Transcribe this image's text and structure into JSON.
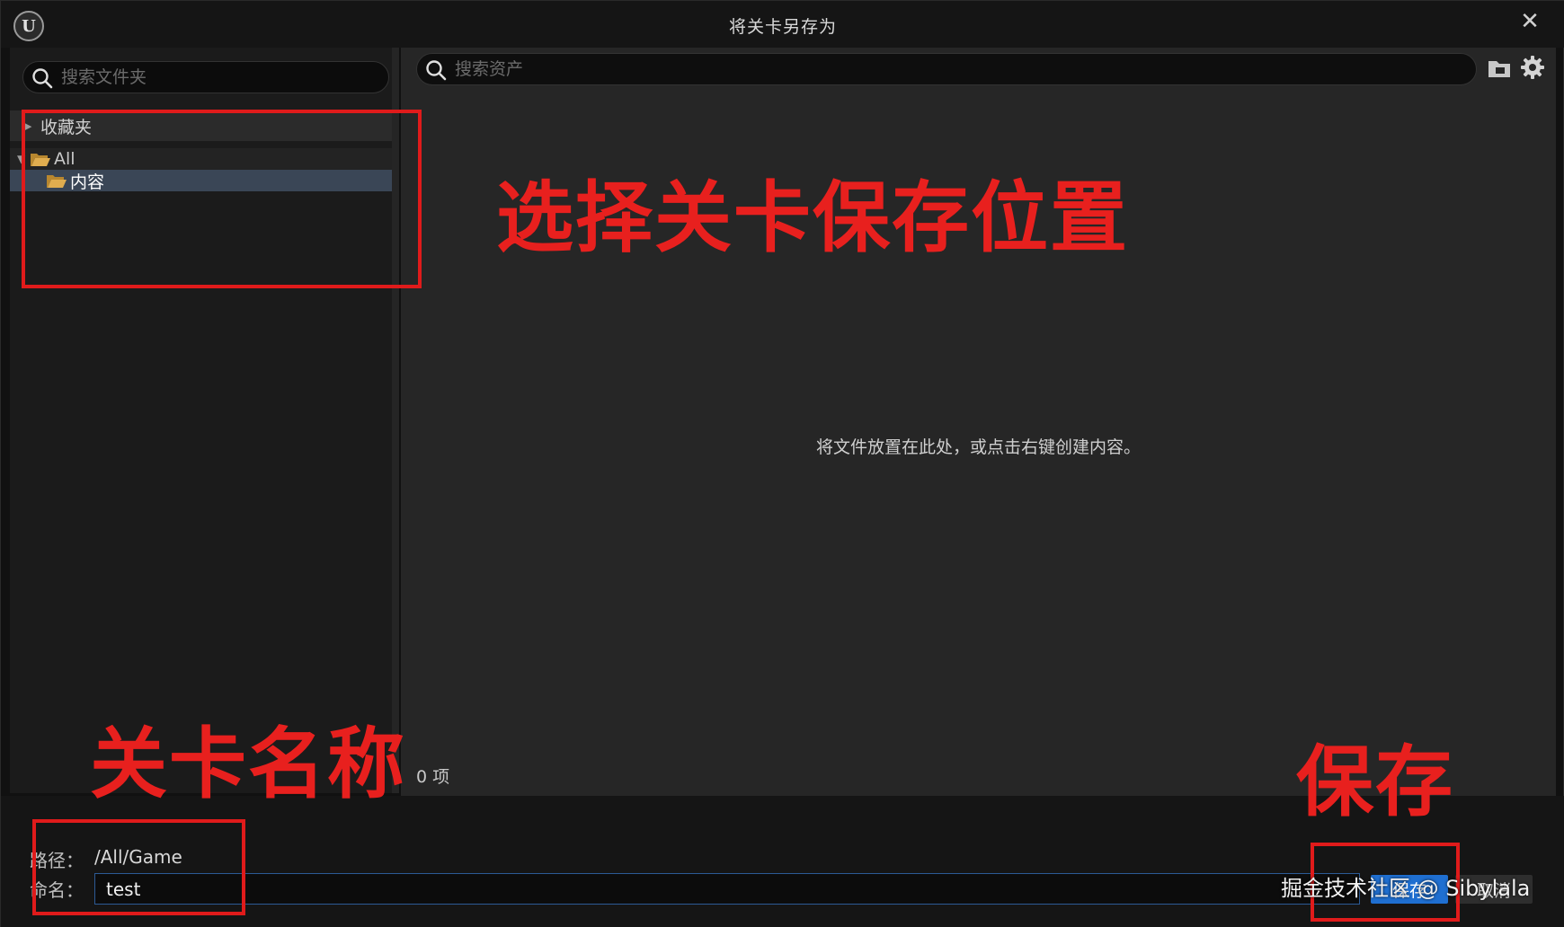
{
  "window": {
    "title": "将关卡另存为",
    "close_symbol": "✕",
    "logo_text": "U"
  },
  "left_pane": {
    "search_placeholder": "搜索文件夹",
    "favorites_label": "收藏夹",
    "tree": {
      "root_label": "All",
      "child_label": "内容"
    }
  },
  "right_pane": {
    "search_placeholder": "搜索资产",
    "empty_hint": "将文件放置在此处，或点击右键创建内容。",
    "item_count": "0 项"
  },
  "bottom": {
    "path_label": "路径：",
    "path_value": "/All/Game",
    "name_label": "命名：",
    "name_value": "test",
    "save_label": "保存",
    "cancel_label": "取消"
  },
  "annotations": {
    "location": "选择关卡保存位置",
    "name": "关卡名称",
    "save": "保存"
  },
  "watermark": "掘金技术社区 @ Sibylala",
  "colors": {
    "annotation_red": "#e01b1b",
    "save_button": "#1f6fd1",
    "selected_row": "#3a4656",
    "folder": "#d9a548"
  },
  "icons": [
    "ue-logo-icon",
    "close-icon",
    "search-icon",
    "folder-icon",
    "folder-open-icon",
    "gear-icon",
    "caret-right-icon",
    "caret-down-icon"
  ]
}
